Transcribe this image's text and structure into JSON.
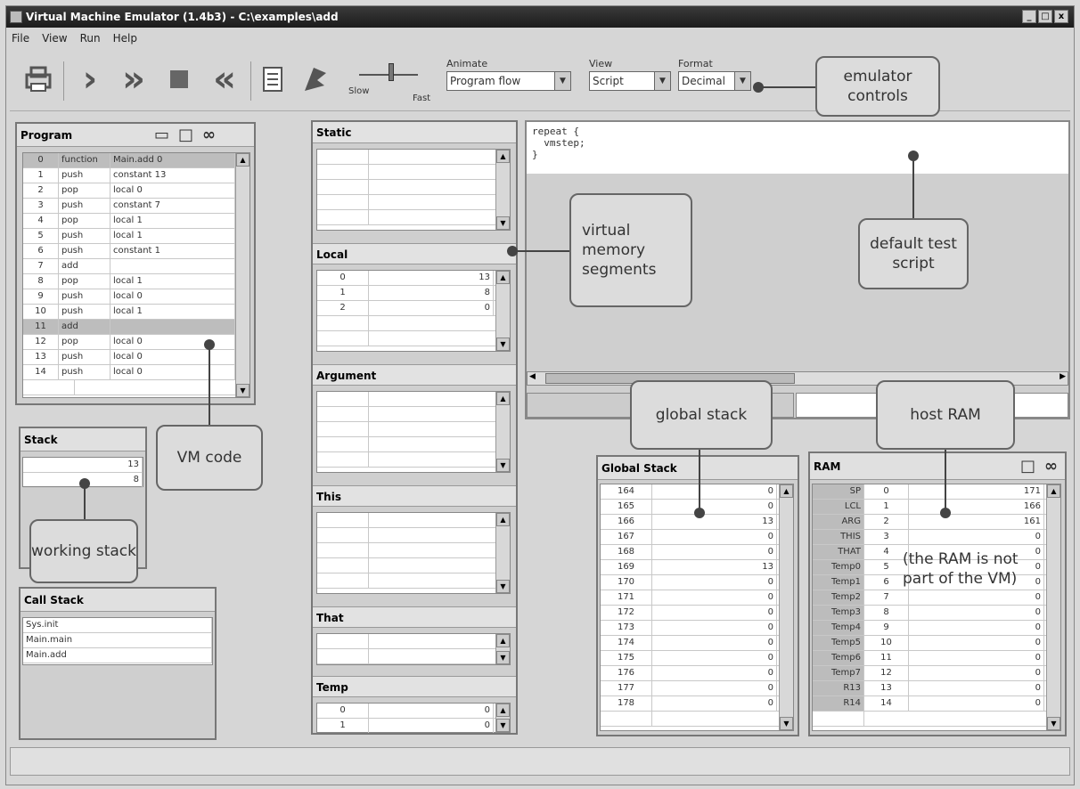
{
  "window": {
    "title": "Virtual Machine Emulator (1.4b3) - C:\\examples\\add",
    "buttons": [
      "_",
      "□",
      "x"
    ]
  },
  "menu": [
    "File",
    "View",
    "Run",
    "Help"
  ],
  "toolbar": {
    "slider": {
      "slow": "Slow",
      "fast": "Fast",
      "level": 0.55
    },
    "animate": {
      "label": "Animate",
      "value": "Program flow"
    },
    "view": {
      "label": "View",
      "value": "Script"
    },
    "format": {
      "label": "Format",
      "value": "Decimal"
    }
  },
  "program": {
    "title": "Program",
    "rows": [
      [
        "0",
        "function",
        "Main.add 0"
      ],
      [
        "1",
        "push",
        "constant 13"
      ],
      [
        "2",
        "pop",
        "local 0"
      ],
      [
        "3",
        "push",
        "constant 7"
      ],
      [
        "4",
        "pop",
        "local 1"
      ],
      [
        "5",
        "push",
        "local 1"
      ],
      [
        "6",
        "push",
        "constant 1"
      ],
      [
        "7",
        "add",
        ""
      ],
      [
        "8",
        "pop",
        "local 1"
      ],
      [
        "9",
        "push",
        "local 0"
      ],
      [
        "10",
        "push",
        "local 1"
      ],
      [
        "11",
        "add",
        ""
      ],
      [
        "12",
        "pop",
        "local 0"
      ],
      [
        "13",
        "push",
        "local 0"
      ],
      [
        "14",
        "push",
        "local 0"
      ]
    ]
  },
  "stack": {
    "title": "Stack",
    "values": [
      "13",
      "8"
    ]
  },
  "call_stack": {
    "title": "Call Stack",
    "items": [
      "Sys.init",
      "Main.main",
      "Main.add"
    ]
  },
  "segments": {
    "static": {
      "title": "Static"
    },
    "local": {
      "title": "Local",
      "rows": [
        [
          "0",
          "13"
        ],
        [
          "1",
          "8"
        ],
        [
          "2",
          "0"
        ]
      ]
    },
    "argument": {
      "title": "Argument"
    },
    "this": {
      "title": "This"
    },
    "that": {
      "title": "That"
    },
    "temp": {
      "title": "Temp",
      "rows": [
        [
          "0",
          "0"
        ],
        [
          "1",
          "0"
        ]
      ]
    }
  },
  "script": {
    "lines": [
      "repeat {",
      "  vmstep;",
      "}"
    ]
  },
  "global_stack": {
    "title": "Global Stack",
    "rows": [
      [
        "164",
        "0"
      ],
      [
        "165",
        "0"
      ],
      [
        "166",
        "13"
      ],
      [
        "167",
        "0"
      ],
      [
        "168",
        "0"
      ],
      [
        "169",
        "13"
      ],
      [
        "170",
        "0"
      ],
      [
        "171",
        "0"
      ],
      [
        "172",
        "0"
      ],
      [
        "173",
        "0"
      ],
      [
        "174",
        "0"
      ],
      [
        "175",
        "0"
      ],
      [
        "176",
        "0"
      ],
      [
        "177",
        "0"
      ],
      [
        "178",
        "0"
      ]
    ]
  },
  "ram": {
    "title": "RAM",
    "rows": [
      [
        "SP",
        "0",
        "171"
      ],
      [
        "LCL",
        "1",
        "166"
      ],
      [
        "ARG",
        "2",
        "161"
      ],
      [
        "THIS",
        "3",
        "0"
      ],
      [
        "THAT",
        "4",
        "0"
      ],
      [
        "Temp0",
        "5",
        "0"
      ],
      [
        "Temp1",
        "6",
        "0"
      ],
      [
        "Temp2",
        "7",
        "0"
      ],
      [
        "Temp3",
        "8",
        "0"
      ],
      [
        "Temp4",
        "9",
        "0"
      ],
      [
        "Temp5",
        "10",
        "0"
      ],
      [
        "Temp6",
        "11",
        "0"
      ],
      [
        "Temp7",
        "12",
        "0"
      ],
      [
        "R13",
        "13",
        "0"
      ],
      [
        "R14",
        "14",
        "0"
      ]
    ]
  },
  "callouts": {
    "emulator_controls": "emulator controls",
    "virtual_memory": "virtual memory segments",
    "default_test_script": "default test script",
    "global_stack": "global stack",
    "host_ram": "host RAM",
    "ram_note": "(the RAM is not part of the VM)",
    "vm_code": "VM code",
    "working_stack": "working stack"
  }
}
